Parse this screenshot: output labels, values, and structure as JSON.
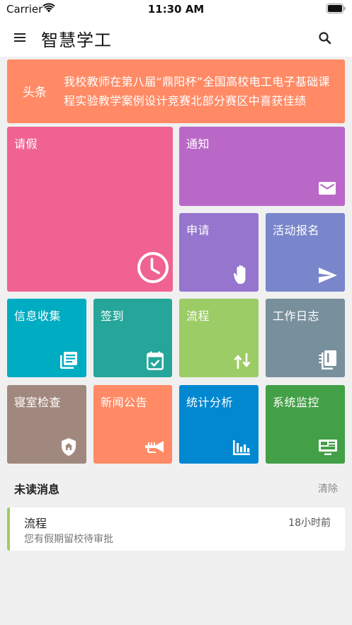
{
  "status_bar": {
    "carrier": "Carrier",
    "time": "11:30 AM"
  },
  "nav": {
    "title": "智慧学工",
    "menu_icon": "hamburger-menu-icon",
    "search_icon": "search-icon"
  },
  "headline": {
    "tag": "头条",
    "text": "我校教师在第八届“鼎阳杯”全国高校电工电子基础课程实验教学案例设计竞赛北部分赛区中喜获佳绩",
    "color": "#ff8a65"
  },
  "tiles": [
    {
      "id": "leave",
      "label": "请假",
      "icon": "clock-icon",
      "color": "#f06292"
    },
    {
      "id": "notice",
      "label": "通知",
      "icon": "mail-icon",
      "color": "#ba68c8"
    },
    {
      "id": "apply",
      "label": "申请",
      "icon": "hand-icon",
      "color": "#9575cd"
    },
    {
      "id": "activity",
      "label": "活动报名",
      "icon": "send-icon",
      "color": "#7986cb"
    },
    {
      "id": "info-collect",
      "label": "信息收集",
      "icon": "library-books-icon",
      "color": "#00acc1"
    },
    {
      "id": "checkin",
      "label": "签到",
      "icon": "calendar-check-icon",
      "color": "#26a69a"
    },
    {
      "id": "process",
      "label": "流程",
      "icon": "swap-vertical-icon",
      "color": "#9ccc65"
    },
    {
      "id": "work-log",
      "label": "工作日志",
      "icon": "notebook-icon",
      "color": "#78909c"
    },
    {
      "id": "dorm-check",
      "label": "寝室检查",
      "icon": "shield-home-icon",
      "color": "#a1887f"
    },
    {
      "id": "news",
      "label": "新闻公告",
      "icon": "trumpet-icon",
      "color": "#ff8a65"
    },
    {
      "id": "statistics",
      "label": "统计分析",
      "icon": "bar-chart-icon",
      "color": "#0288d1"
    },
    {
      "id": "monitor",
      "label": "系统监控",
      "icon": "monitor-dashboard-icon",
      "color": "#43a047"
    }
  ],
  "unread": {
    "title": "未读消息",
    "clear_label": "清除",
    "messages": [
      {
        "title": "流程",
        "time": "18小时前",
        "body": "您有假期留校待审批",
        "accent_color": "#9ccc65"
      }
    ]
  }
}
